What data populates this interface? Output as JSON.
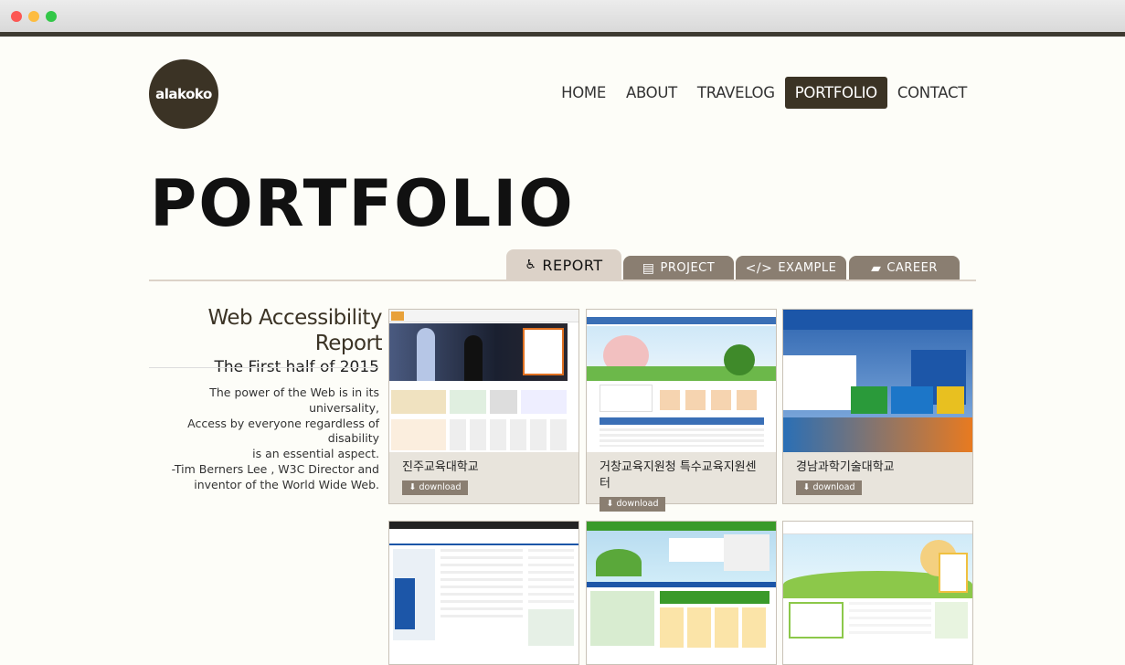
{
  "logo": {
    "text": "alakoko"
  },
  "nav": [
    {
      "label": "HOME"
    },
    {
      "label": "ABOUT"
    },
    {
      "label": "TRAVELOG"
    },
    {
      "label": "PORTFOLIO",
      "active": true
    },
    {
      "label": "CONTACT"
    }
  ],
  "page_title": "PORTFOLIO",
  "tabs": [
    {
      "label": "REPORT",
      "icon": "wheelchair-icon",
      "active": true
    },
    {
      "label": "PROJECT",
      "icon": "code-file-icon"
    },
    {
      "label": "EXAMPLE",
      "icon": "code-brackets-icon"
    },
    {
      "label": "CAREER",
      "icon": "briefcase-icon"
    }
  ],
  "report": {
    "title": "Web Accessibility Report",
    "subtitle": "The First half of 2015",
    "quote": [
      "The power of the Web is in its universality,",
      "Access by everyone regardless of disability",
      "is an essential aspect.",
      "-Tim Berners Lee , W3C Director and",
      "inventor of the World Wide Web."
    ]
  },
  "cards": [
    {
      "name": "진주교육대학교",
      "download": "download"
    },
    {
      "name": "거창교육지원청 특수교육지원센터",
      "download": "download"
    },
    {
      "name": "경남과학기술대학교",
      "download": "download"
    },
    {
      "name": "",
      "download": ""
    },
    {
      "name": "",
      "download": ""
    },
    {
      "name": "",
      "download": ""
    }
  ],
  "colors": {
    "brand": "#3b3325",
    "tab_inactive": "#8a7e71",
    "tab_active": "#dcd2c8",
    "background": "#fdfdf8"
  }
}
